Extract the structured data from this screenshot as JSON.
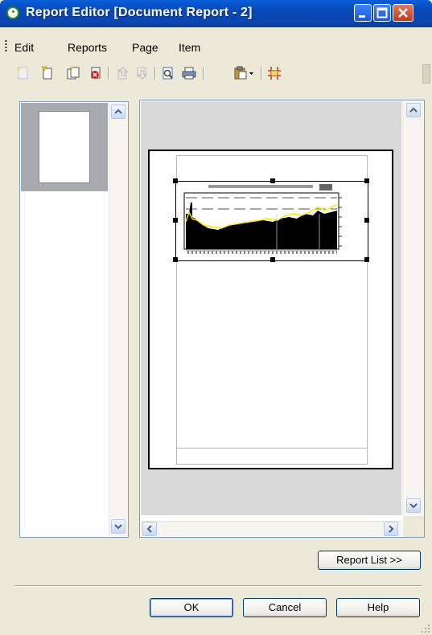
{
  "window": {
    "title": "Report Editor [Document Report - 2]"
  },
  "menu": {
    "items": [
      "Edit",
      "Reports",
      "Page",
      "Item"
    ]
  },
  "toolbar": {
    "icons": [
      "new-report-icon",
      "new-page-icon",
      "copy-page-icon",
      "delete-page-icon",
      "move-up-icon",
      "move-down-icon",
      "print-preview-icon",
      "print-icon",
      "paste-dropdown-icon",
      "align-grid-icon"
    ]
  },
  "buttons": {
    "report_list": "Report List >>",
    "ok": "OK",
    "cancel": "Cancel",
    "help": "Help"
  },
  "colors": {
    "titlebar": "#0a46b0",
    "chart_line": "#ffe400"
  }
}
